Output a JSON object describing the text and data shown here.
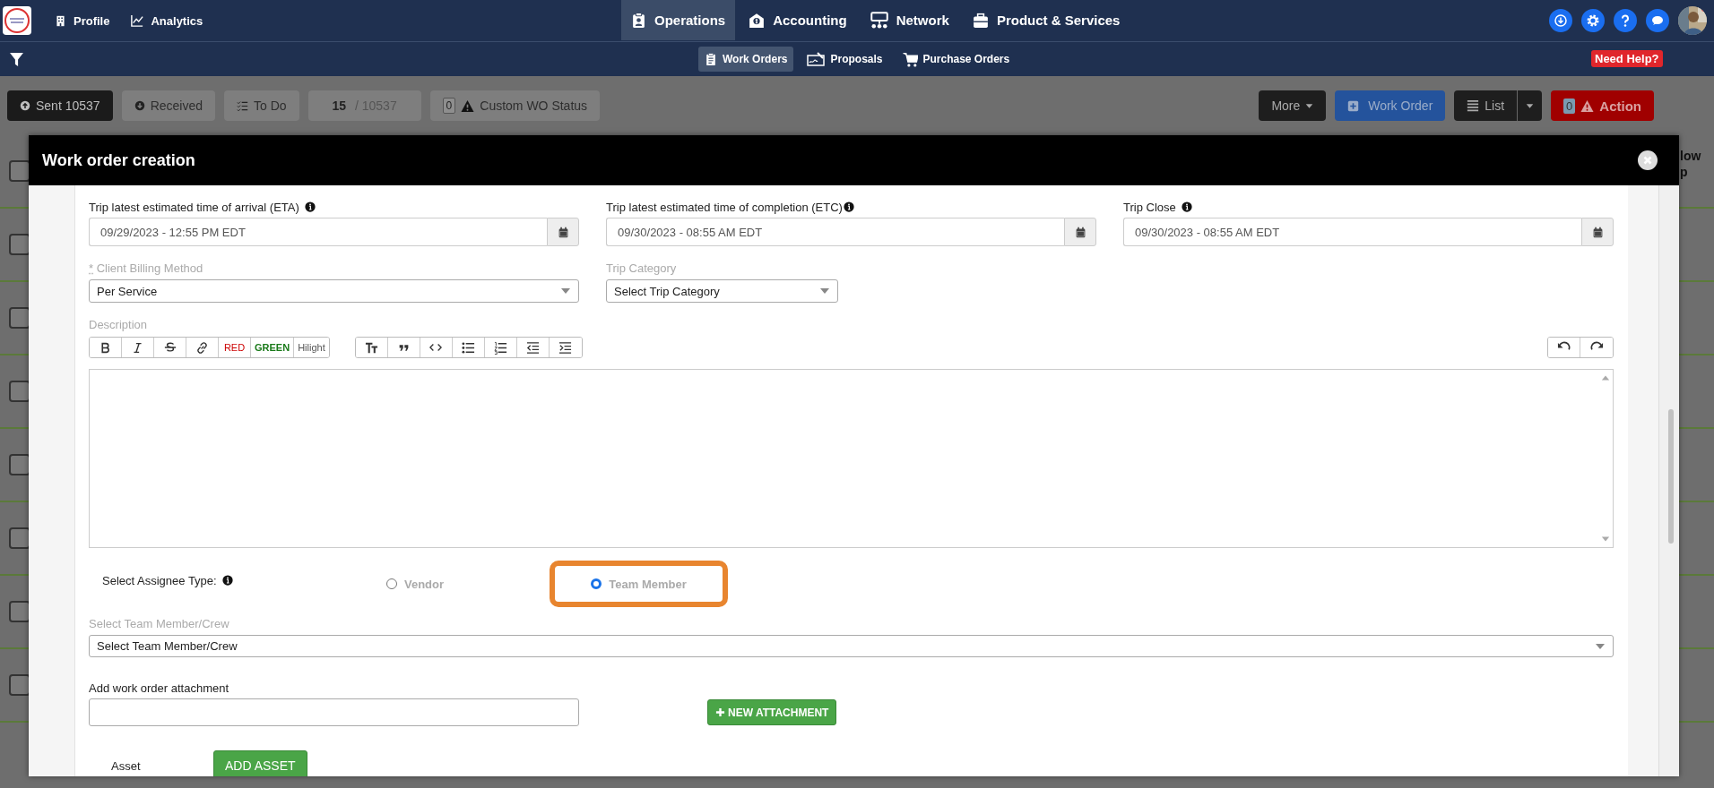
{
  "left_links": [
    "Profile",
    "Analytics"
  ],
  "main_tabs": [
    {
      "label": "Operations",
      "selected": true
    },
    {
      "label": "Accounting",
      "selected": false
    },
    {
      "label": "Network",
      "selected": false
    },
    {
      "label": "Product & Services",
      "selected": false
    }
  ],
  "sub_tabs": [
    {
      "label": "Work Orders",
      "selected": true
    },
    {
      "label": "Proposals",
      "selected": false
    },
    {
      "label": "Purchase Orders",
      "selected": false
    }
  ],
  "help_badge": "Need Help?",
  "status_filters": [
    {
      "label": "Sent 10537",
      "selected": true
    },
    {
      "label": "Received",
      "selected": false
    },
    {
      "label": "To Do",
      "selected": false
    }
  ],
  "counter": {
    "current": "15",
    "separator": "/",
    "total": "10537"
  },
  "custom_status": {
    "count": "0",
    "label": "Custom WO Status"
  },
  "actions": {
    "more": "More",
    "new": "Work Order",
    "view": "List",
    "action_count": "0",
    "action": "Action"
  },
  "background": {
    "header_fragment": [
      "low",
      "p"
    ],
    "rows": [
      {
        "checked": false
      },
      {
        "checked": false
      },
      {
        "checked": false
      },
      {
        "checked": false
      },
      {
        "checked": false
      },
      {
        "checked": false
      },
      {
        "checked": false
      },
      {
        "checked": false
      }
    ]
  },
  "modal": {
    "title": "Work order creation",
    "date_fields": [
      {
        "label": "Trip latest estimated time of arrival (ETA)",
        "value": "09/29/2023 - 12:55 PM EDT"
      },
      {
        "label": "Trip latest estimated time of completion (ETC)",
        "value": "09/30/2023 - 08:55 AM EDT"
      },
      {
        "label": "Trip Close",
        "value": "09/30/2023 - 08:55 AM EDT"
      }
    ],
    "billing": {
      "required_mark": "*",
      "label": "Client Billing Method",
      "value": "Per Service"
    },
    "trip_category": {
      "label": "Trip Category",
      "value": "Select Trip Category"
    },
    "description": {
      "label": "Description",
      "color_buttons": [
        "RED",
        "GREEN",
        "Hilight"
      ]
    },
    "assignee": {
      "label": "Select Assignee Type:",
      "options": [
        {
          "label": "Vendor",
          "selected": false,
          "highlighted": false
        },
        {
          "label": "Team Member",
          "selected": true,
          "highlighted": true
        }
      ]
    },
    "team_select": {
      "label": "Select Team Member/Crew",
      "value": "Select Team Member/Crew"
    },
    "attachment": {
      "label": "Add work order attachment",
      "button": "NEW ATTACHMENT"
    },
    "asset": {
      "label": "Asset",
      "button": "ADD ASSET"
    }
  }
}
